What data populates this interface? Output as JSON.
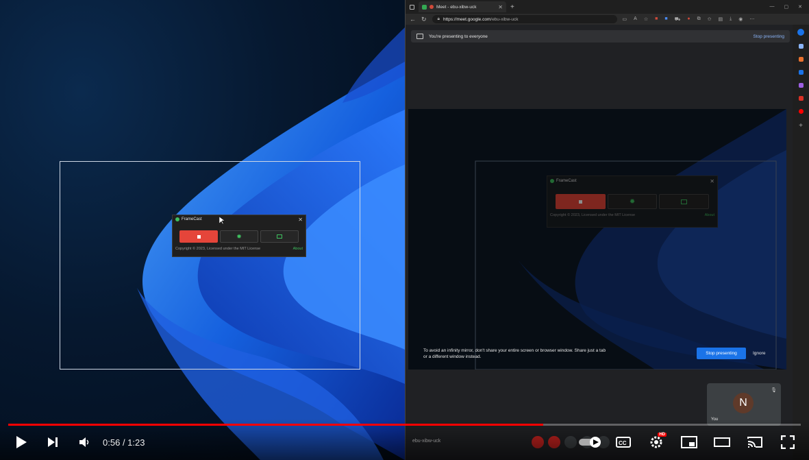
{
  "framecast_left": {
    "title": "FrameCast",
    "copyright": "Copyright © 2023, Licensed under the MIT License",
    "about": "About"
  },
  "browser": {
    "tab_title": "Meet - ebu-xibw-uck",
    "url_host": "https://meet.google.com",
    "url_path": "/ebu-xibw-uck",
    "presenting_banner": "You're presenting to everyone",
    "stop_presenting_link": "Stop presenting",
    "framecast_mirror_title": "FrameCast",
    "framecast_mirror_copyright": "Copyright © 2023, Licensed under the MIT License",
    "framecast_mirror_about": "About",
    "mirror_warning": "To avoid an infinity mirror, don't share your entire screen or browser window. Share just a tab or a different window instead.",
    "stop_presenting_button": "Stop presenting",
    "ignore_button": "Ignore",
    "self_avatar_letter": "N",
    "self_label": "You",
    "meeting_code": "ebu-xibw-uck"
  },
  "player": {
    "current_time": "0:56",
    "duration": "1:23",
    "progress_fraction": 0.675,
    "hd_badge": "HD"
  },
  "colors": {
    "progress": "#ff0000",
    "stop_button": "#e5453a",
    "meet_blue": "#1a73e8",
    "link_blue": "#8ab4f8"
  }
}
